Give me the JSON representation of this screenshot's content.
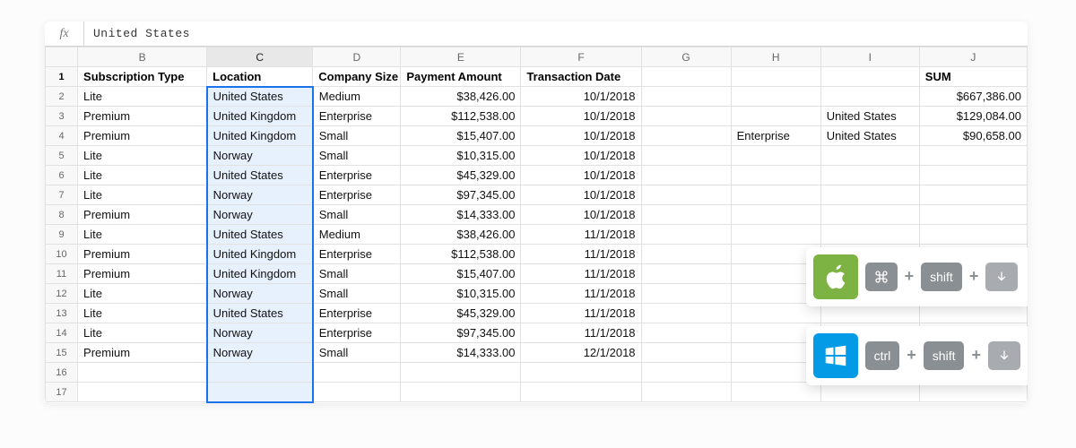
{
  "formula_bar": {
    "fx": "fx",
    "value": "United States"
  },
  "columns": [
    "",
    "B",
    "C",
    "D",
    "E",
    "F",
    "G",
    "H",
    "I",
    "J"
  ],
  "row_numbers": [
    1,
    2,
    3,
    4,
    5,
    6,
    7,
    8,
    9,
    10,
    11,
    12,
    13,
    14,
    15,
    16,
    17
  ],
  "headers": {
    "B": "Subscription Type",
    "C": "Location",
    "D": "Company Size",
    "E": "Payment Amount",
    "F": "Transaction Date",
    "J": "SUM"
  },
  "rows": [
    {
      "B": "Lite",
      "C": "United States",
      "D": "Medium",
      "E": "$38,426.00",
      "F": "10/1/2018",
      "H": "",
      "I": "",
      "J": "$667,386.00"
    },
    {
      "B": "Premium",
      "C": "United Kingdom",
      "D": "Enterprise",
      "E": "$112,538.00",
      "F": "10/1/2018",
      "H": "",
      "I": "United States",
      "J": "$129,084.00"
    },
    {
      "B": "Premium",
      "C": "United Kingdom",
      "D": "Small",
      "E": "$15,407.00",
      "F": "10/1/2018",
      "H": "Enterprise",
      "I": "United States",
      "J": "$90,658.00"
    },
    {
      "B": "Lite",
      "C": "Norway",
      "D": "Small",
      "E": "$10,315.00",
      "F": "10/1/2018"
    },
    {
      "B": "Lite",
      "C": "United States",
      "D": "Enterprise",
      "E": "$45,329.00",
      "F": "10/1/2018"
    },
    {
      "B": "Lite",
      "C": "Norway",
      "D": "Enterprise",
      "E": "$97,345.00",
      "F": "10/1/2018"
    },
    {
      "B": "Premium",
      "C": "Norway",
      "D": "Small",
      "E": "$14,333.00",
      "F": "10/1/2018"
    },
    {
      "B": "Lite",
      "C": "United States",
      "D": "Medium",
      "E": "$38,426.00",
      "F": "11/1/2018"
    },
    {
      "B": "Premium",
      "C": "United Kingdom",
      "D": "Enterprise",
      "E": "$112,538.00",
      "F": "11/1/2018"
    },
    {
      "B": "Premium",
      "C": "United Kingdom",
      "D": "Small",
      "E": "$15,407.00",
      "F": "11/1/2018"
    },
    {
      "B": "Lite",
      "C": "Norway",
      "D": "Small",
      "E": "$10,315.00",
      "F": "11/1/2018"
    },
    {
      "B": "Lite",
      "C": "United States",
      "D": "Enterprise",
      "E": "$45,329.00",
      "F": "11/1/2018"
    },
    {
      "B": "Lite",
      "C": "Norway",
      "D": "Enterprise",
      "E": "$97,345.00",
      "F": "11/1/2018"
    },
    {
      "B": "Premium",
      "C": "Norway",
      "D": "Small",
      "E": "$14,333.00",
      "F": "12/1/2018"
    }
  ],
  "shortcuts": {
    "mac": {
      "k1": "⌘",
      "k2": "shift",
      "k3": "↓"
    },
    "win": {
      "k1": "ctrl",
      "k2": "shift",
      "k3": "↓"
    },
    "plus": "+"
  }
}
